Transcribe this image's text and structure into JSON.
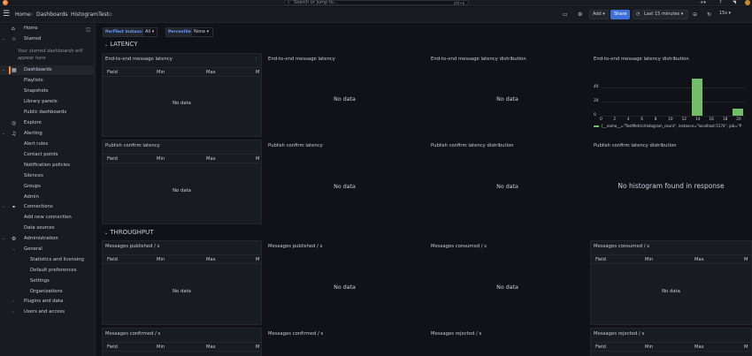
{
  "topbar": {
    "search_placeholder": "Search or jump to...",
    "search_shortcut": "ctrl+k",
    "plus_icon": "+",
    "help_icon": "?",
    "news_icon": "rss"
  },
  "breadcrumb": {
    "home": "Home",
    "dashboards": "Dashboards",
    "current": "HistogramTest"
  },
  "toolbar": {
    "add_label": "Add",
    "share_label": "Share",
    "time_range": "Last 15 minutes",
    "refresh_interval": "15s"
  },
  "sidebar": {
    "starred_empty_text": "Your starred dashboards will appear here",
    "items": [
      {
        "label": "Home",
        "icon": "home-icon"
      },
      {
        "label": "Starred",
        "icon": "star-icon"
      },
      {
        "label": "Dashboards",
        "icon": "dashboards-icon"
      },
      {
        "label": "Playlists"
      },
      {
        "label": "Snapshots"
      },
      {
        "label": "Library panels"
      },
      {
        "label": "Public dashboards"
      },
      {
        "label": "Explore",
        "icon": "compass-icon"
      },
      {
        "label": "Alerting",
        "icon": "bell-icon"
      },
      {
        "label": "Alert rules"
      },
      {
        "label": "Contact points"
      },
      {
        "label": "Notification policies"
      },
      {
        "label": "Silences"
      },
      {
        "label": "Groups"
      },
      {
        "label": "Admin"
      },
      {
        "label": "Connections",
        "icon": "connections-icon"
      },
      {
        "label": "Add new connection"
      },
      {
        "label": "Data sources"
      },
      {
        "label": "Administration",
        "icon": "gear-icon"
      },
      {
        "label": "General"
      },
      {
        "label": "Statistics and licensing"
      },
      {
        "label": "Default preferences"
      },
      {
        "label": "Settings"
      },
      {
        "label": "Organizations"
      },
      {
        "label": "Plugins and data"
      },
      {
        "label": "Users and access"
      }
    ]
  },
  "variables": {
    "perftest_label": "PerfTest Instance",
    "perftest_value": "All",
    "percentile_label": "Percentile",
    "percentile_value": "None"
  },
  "rows": {
    "latency": "LATENCY",
    "throughput": "THROUGHPUT"
  },
  "table_headers": {
    "field": "Field",
    "min": "Min",
    "max": "Max",
    "mean": "M"
  },
  "panels": {
    "e2e_table": "End-to-end message latency",
    "e2e_graph": "End-to-end message latency",
    "e2e_dist_1": "End-to-end message latency distribution",
    "e2e_dist_2": "End-to-end message latency distribution",
    "pub_table": "Publish confirm latency",
    "pub_graph": "Publish confirm latency",
    "pub_dist_1": "Publish confirm latency distribution",
    "pub_dist_2": "Publish confirm latency distribution",
    "msg_pub_table": "Messages published / s",
    "msg_pub_graph": "Messages published / s",
    "msg_cons_graph": "Messages consumed / s",
    "msg_cons_table": "Messages consumed / s",
    "msg_conf_table": "Messages confirmed / s",
    "msg_conf_graph": "Messages confirmed / s",
    "msg_rej_graph": "Messages rejected / s",
    "msg_rej_table": "Messages rejected / s",
    "no_data": "No data",
    "no_histogram": "No histogram found in response"
  },
  "histogram": {
    "y_ticks": [
      "40",
      "20",
      "0"
    ],
    "x_ticks": [
      "0",
      "2",
      "4",
      "6",
      "8",
      "10",
      "12",
      "14",
      "16",
      "18",
      "20"
    ],
    "legend": "{__name__=\"TestMetricHistogram_count\", instance=\"localhost:5174\", job=\"P"
  },
  "chart_data": {
    "type": "bar",
    "x": [
      0,
      2,
      4,
      6,
      8,
      10,
      12,
      14,
      16,
      18,
      20
    ],
    "values": [
      0,
      0,
      0,
      0,
      0,
      0,
      0,
      52,
      0,
      0,
      10
    ],
    "ylim": [
      0,
      60
    ],
    "xlim": [
      0,
      21
    ],
    "grid": true,
    "legend_position": "bottom",
    "color": "#73bf69"
  }
}
